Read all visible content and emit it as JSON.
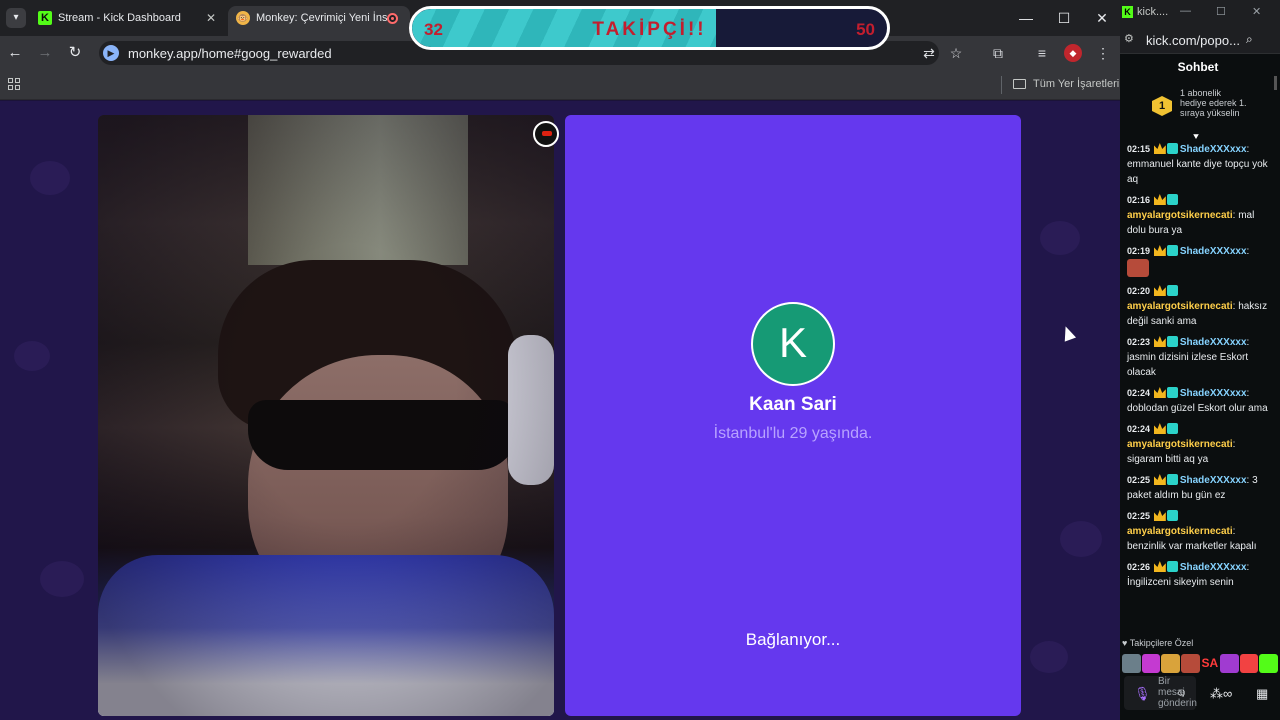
{
  "browser": {
    "tabs": [
      {
        "title": "Stream - Kick Dashboard",
        "favicon": "kick-icon"
      },
      {
        "title": "Monkey: Çevrimiçi Yeni İnsa",
        "favicon": "monkey-icon"
      }
    ],
    "url": "monkey.app/home#goog_rewarded",
    "bookmarks_label": "Tüm Yer İşaretleri"
  },
  "goal": {
    "title": "TAKİPÇİ!!",
    "current": "32",
    "target": "50",
    "progress_fraction": 0.64,
    "colors": {
      "fill": "#3ec9cc",
      "text": "#c31e2e",
      "border": "#ffffff"
    }
  },
  "monkey": {
    "match_initial": "K",
    "match_name": "Kaan Sari",
    "match_subtitle": "İstanbul'lu 29 yaşında.",
    "status": "Bağlanıyor...",
    "colors": {
      "card": "#6538ee",
      "avatar": "#169a75",
      "page": "#21164a"
    }
  },
  "chat": {
    "window_title": "kick....",
    "url": "kick.com/popo...",
    "header": "Sohbet",
    "pinned": {
      "badge": "1",
      "text": "1 abonelik hediye ederek 1. sıraya yükselin"
    },
    "messages": [
      {
        "time": "02:15",
        "user": "ShadeXXXxxx",
        "text": "emmanuel kante diye topçu yok aq",
        "color_class": "u1"
      },
      {
        "time": "02:16",
        "user": "amyalargotsikernecati",
        "text": "mal dolu bura ya",
        "color_class": "u2"
      },
      {
        "time": "02:19",
        "user": "ShadeXXXxxx",
        "text": "",
        "color_class": "u1",
        "emote": true
      },
      {
        "time": "02:20",
        "user": "amyalargotsikernecati",
        "text": "haksız değil sanki ama",
        "color_class": "u2"
      },
      {
        "time": "02:23",
        "user": "ShadeXXXxxx",
        "text": "jasmin dizisini izlese Eskort olacak",
        "color_class": "u1"
      },
      {
        "time": "02:24",
        "user": "ShadeXXXxxx",
        "text": "doblodan güzel Eskort olur ama",
        "color_class": "u1"
      },
      {
        "time": "02:24",
        "user": "amyalargotsikernecati",
        "text": "sigaram bitti aq ya",
        "color_class": "u2"
      },
      {
        "time": "02:25",
        "user": "ShadeXXXxxx",
        "text": "3 paket aldım bu gün ez",
        "color_class": "u1"
      },
      {
        "time": "02:25",
        "user": "amyalargotsikernecati",
        "text": "benzinlik var marketler kapalı",
        "color_class": "u2"
      },
      {
        "time": "02:26",
        "user": "ShadeXXXxxx",
        "text": "İngilizceni sikeyim senin",
        "color_class": "u1"
      }
    ],
    "followers_only_label": "Takipçilere Özel",
    "emote_labels": [
      "SA"
    ],
    "input_placeholder": "Bir mesaj gönderin",
    "colors": {
      "user_blue": "#86d3ff",
      "user_gold": "#ffcf4a",
      "accent": "#53fc18"
    }
  }
}
